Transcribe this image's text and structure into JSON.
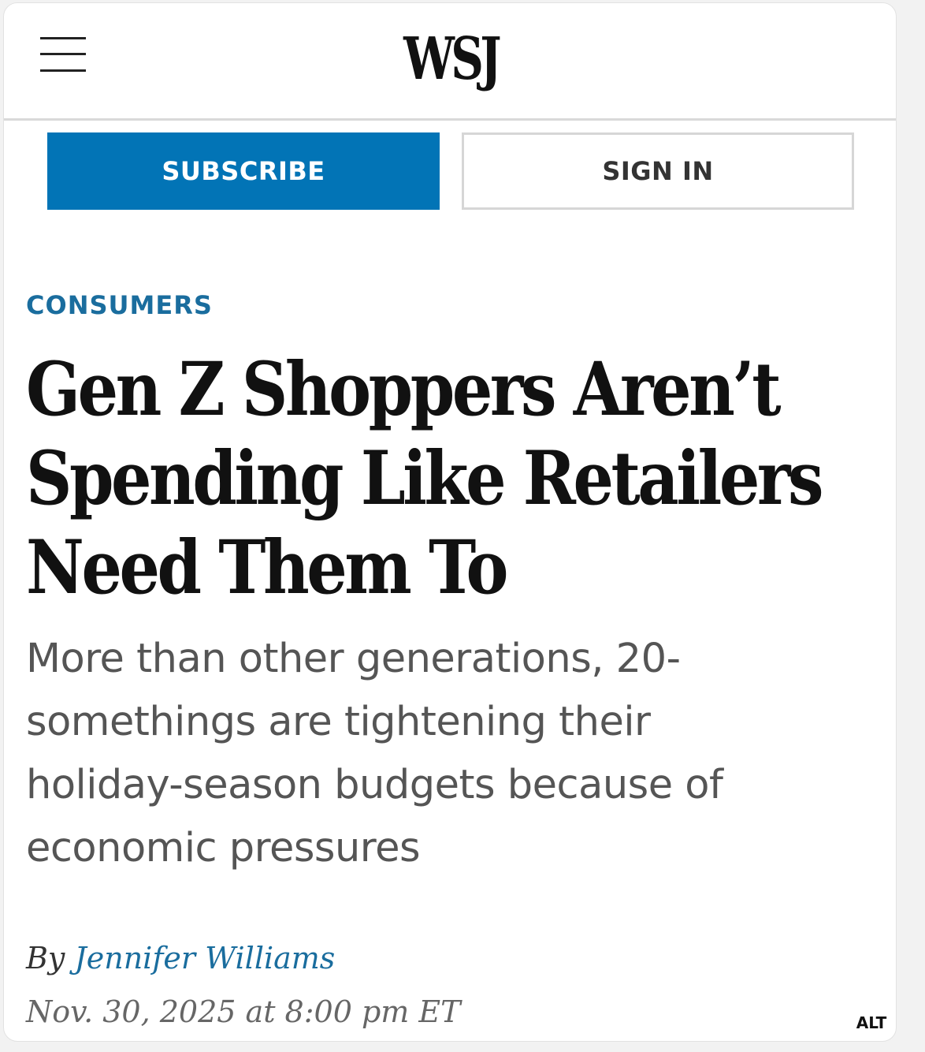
{
  "header": {
    "menu_icon": "hamburger-menu-icon",
    "logo_text": "WSJ"
  },
  "actions": {
    "subscribe_label": "SUBSCRIBE",
    "signin_label": "SIGN IN"
  },
  "article": {
    "section": "CONSUMERS",
    "headline": "Gen Z Shoppers Aren’t Spending Like Retailers Need Them To",
    "dek": "More than other generations, 20-somethings are tightening their holiday-season budgets because of economic pressures",
    "byline_prefix": "By",
    "author": "Jennifer Williams",
    "date": "Nov. 30, 2025 at 8:00 pm ET"
  },
  "overlay": {
    "alt_badge": "ALT"
  },
  "colors": {
    "accent_blue": "#0274b6",
    "section_blue": "#1a6d9e",
    "headline": "#111111",
    "dek": "#555555"
  }
}
